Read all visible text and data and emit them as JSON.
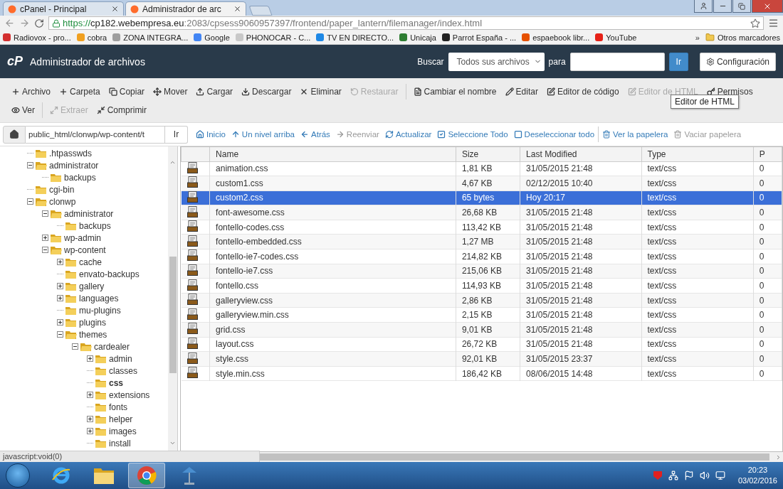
{
  "browser": {
    "tabs": [
      {
        "title": "cPanel - Principal",
        "selected": false
      },
      {
        "title": "Administrador de arc",
        "selected": true
      }
    ],
    "url": {
      "scheme": "https://",
      "host": "cp182.webempresa.eu",
      "rest": ":2083/cpsess9060957397/frontend/paper_lantern/filemanager/index.html"
    },
    "bookmarks": [
      {
        "label": "Radiovox - pro...",
        "color": "#d32f2f"
      },
      {
        "label": "cobra",
        "color": "#f0a020"
      },
      {
        "label": "ZONA INTEGRA...",
        "color": "#9e9e9e"
      },
      {
        "label": "Google",
        "color": "#4285f4"
      },
      {
        "label": "PHONOCAR - C...",
        "color": "#c8c8c8"
      },
      {
        "label": "TV EN DIRECTO...",
        "color": "#1e88e5"
      },
      {
        "label": "Unicaja",
        "color": "#2e7d32"
      },
      {
        "label": "Parrot España - ...",
        "color": "#222222"
      },
      {
        "label": "espaebook libr...",
        "color": "#e65100"
      },
      {
        "label": "YouTube",
        "color": "#e62117"
      }
    ],
    "bookmarks_more": "»",
    "other_bookmarks": "Otros marcadores"
  },
  "header": {
    "logo": "cP",
    "title": "Administrador de archivos",
    "search_label": "Buscar",
    "search_scope": "Todos sus archivos",
    "for_label": "para",
    "go": "Ir",
    "settings": "Configuración"
  },
  "toolbar": {
    "rows": [
      {
        "groups": [
          [
            {
              "label": "Archivo",
              "disabled": false
            },
            {
              "label": "Carpeta",
              "disabled": false
            },
            {
              "label": "Copiar",
              "disabled": false
            },
            {
              "label": "Mover",
              "disabled": false
            },
            {
              "label": "Cargar",
              "disabled": false
            },
            {
              "label": "Descargar",
              "disabled": false
            },
            {
              "label": "Eliminar",
              "disabled": false
            },
            {
              "label": "Restaurar",
              "disabled": true
            }
          ],
          [
            {
              "label": "Cambiar el nombre",
              "disabled": false
            },
            {
              "label": "Editar",
              "disabled": false
            },
            {
              "label": "Editor de código",
              "disabled": false
            },
            {
              "label": "Editor de HTML",
              "disabled": true
            },
            {
              "label": "Permisos",
              "disabled": false
            }
          ]
        ]
      },
      {
        "groups": [
          [
            {
              "label": "Ver",
              "disabled": false
            }
          ],
          [
            {
              "label": "Extraer",
              "disabled": true
            },
            {
              "label": "Comprimir",
              "disabled": false
            }
          ]
        ]
      }
    ],
    "tooltip": "Editor de HTML"
  },
  "nav": {
    "path": "public_html/clonwp/wp-content/t",
    "go": "Ir",
    "links": [
      {
        "label": "Inicio",
        "disabled": false
      },
      {
        "label": "Un nivel arriba",
        "disabled": false
      },
      {
        "label": "Atrás",
        "disabled": false
      },
      {
        "label": "Reenviar",
        "disabled": true
      },
      {
        "label": "Actualizar",
        "disabled": false
      },
      {
        "label": "Seleccione Todo",
        "disabled": false
      },
      {
        "label": "Deseleccionar todo",
        "disabled": false
      }
    ],
    "trash_links": [
      {
        "label": "Ver la papelera",
        "disabled": false
      },
      {
        "label": "Vaciar papelera",
        "disabled": true
      }
    ]
  },
  "tree": [
    {
      "name": ".htpasswds",
      "selected": false
    },
    {
      "name": "administrator",
      "selected": false,
      "expanded": true,
      "children": [
        {
          "name": "backups",
          "selected": false
        }
      ]
    },
    {
      "name": "cgi-bin",
      "selected": false
    },
    {
      "name": "clonwp",
      "selected": false,
      "expanded": true,
      "children": [
        {
          "name": "administrator",
          "selected": false,
          "expanded": true,
          "children": [
            {
              "name": "backups",
              "selected": false
            }
          ]
        },
        {
          "name": "wp-admin",
          "selected": false,
          "expanded": false
        },
        {
          "name": "wp-content",
          "selected": false,
          "expanded": true,
          "children": [
            {
              "name": "cache",
              "selected": false,
              "expanded": false
            },
            {
              "name": "envato-backups",
              "selected": false
            },
            {
              "name": "gallery",
              "selected": false,
              "expanded": false
            },
            {
              "name": "languages",
              "selected": false,
              "expanded": false
            },
            {
              "name": "mu-plugins",
              "selected": false
            },
            {
              "name": "plugins",
              "selected": false,
              "expanded": false
            },
            {
              "name": "themes",
              "selected": false,
              "expanded": true,
              "children": [
                {
                  "name": "cardealer",
                  "selected": false,
                  "expanded": true,
                  "children": [
                    {
                      "name": "admin",
                      "selected": false,
                      "expanded": false
                    },
                    {
                      "name": "classes",
                      "selected": false
                    },
                    {
                      "name": "css",
                      "selected": true
                    },
                    {
                      "name": "extensions",
                      "selected": false,
                      "expanded": false
                    },
                    {
                      "name": "fonts",
                      "selected": false
                    },
                    {
                      "name": "helper",
                      "selected": false,
                      "expanded": false
                    },
                    {
                      "name": "images",
                      "selected": false,
                      "expanded": false
                    },
                    {
                      "name": "install",
                      "selected": false
                    }
                  ]
                }
              ]
            }
          ]
        }
      ]
    }
  ],
  "table": {
    "columns": [
      "Name",
      "Size",
      "Last Modified",
      "Type",
      "P"
    ],
    "rows": [
      {
        "cells": [
          "animation.css",
          "1,81 KB",
          "31/05/2015 21:48",
          "text/css",
          "0"
        ],
        "selected": false
      },
      {
        "cells": [
          "custom1.css",
          "4,67 KB",
          "02/12/2015 10:40",
          "text/css",
          "0"
        ],
        "selected": false
      },
      {
        "cells": [
          "custom2.css",
          "65 bytes",
          "Hoy 20:17",
          "text/css",
          "0"
        ],
        "selected": true
      },
      {
        "cells": [
          "font-awesome.css",
          "26,68 KB",
          "31/05/2015 21:48",
          "text/css",
          "0"
        ],
        "selected": false
      },
      {
        "cells": [
          "fontello-codes.css",
          "113,42 KB",
          "31/05/2015 21:48",
          "text/css",
          "0"
        ],
        "selected": false
      },
      {
        "cells": [
          "fontello-embedded.css",
          "1,27 MB",
          "31/05/2015 21:48",
          "text/css",
          "0"
        ],
        "selected": false
      },
      {
        "cells": [
          "fontello-ie7-codes.css",
          "214,82 KB",
          "31/05/2015 21:48",
          "text/css",
          "0"
        ],
        "selected": false
      },
      {
        "cells": [
          "fontello-ie7.css",
          "215,06 KB",
          "31/05/2015 21:48",
          "text/css",
          "0"
        ],
        "selected": false
      },
      {
        "cells": [
          "fontello.css",
          "114,93 KB",
          "31/05/2015 21:48",
          "text/css",
          "0"
        ],
        "selected": false
      },
      {
        "cells": [
          "galleryview.css",
          "2,86 KB",
          "31/05/2015 21:48",
          "text/css",
          "0"
        ],
        "selected": false
      },
      {
        "cells": [
          "galleryview.min.css",
          "2,15 KB",
          "31/05/2015 21:48",
          "text/css",
          "0"
        ],
        "selected": false
      },
      {
        "cells": [
          "grid.css",
          "9,01 KB",
          "31/05/2015 21:48",
          "text/css",
          "0"
        ],
        "selected": false
      },
      {
        "cells": [
          "layout.css",
          "26,72 KB",
          "31/05/2015 21:48",
          "text/css",
          "0"
        ],
        "selected": false
      },
      {
        "cells": [
          "style.css",
          "92,01 KB",
          "31/05/2015 23:37",
          "text/css",
          "0"
        ],
        "selected": false
      },
      {
        "cells": [
          "style.min.css",
          "186,42 KB",
          "08/06/2015 14:48",
          "text/css",
          "0"
        ],
        "selected": false
      }
    ]
  },
  "status": "javascript:void(0)",
  "taskbar": {
    "apps": [
      {
        "kind": "ie",
        "selected": false
      },
      {
        "kind": "folder",
        "selected": false
      },
      {
        "kind": "chrome",
        "selected": true
      },
      {
        "kind": "lamp",
        "selected": false
      }
    ],
    "time": "20:23",
    "date": "03/02/2016"
  }
}
